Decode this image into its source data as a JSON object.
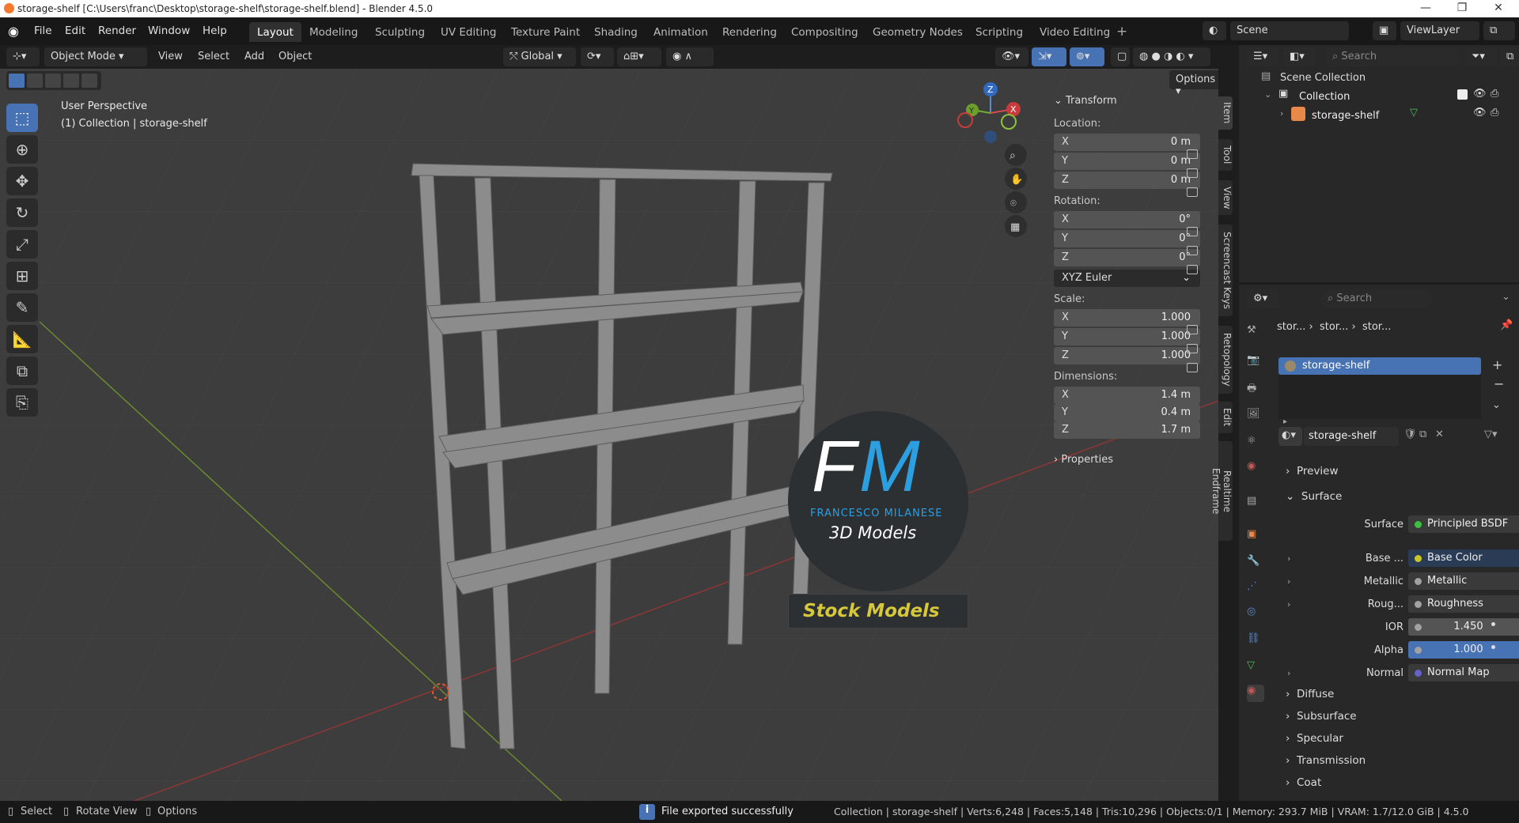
{
  "window": {
    "title": "storage-shelf [C:\\Users\\franc\\Desktop\\storage-shelf\\storage-shelf.blend] - Blender 4.5.0"
  },
  "menu": [
    "File",
    "Edit",
    "Render",
    "Window",
    "Help"
  ],
  "workspaces": [
    "Layout",
    "Modeling",
    "Sculpting",
    "UV Editing",
    "Texture Paint",
    "Shading",
    "Animation",
    "Rendering",
    "Compositing",
    "Geometry Nodes",
    "Scripting",
    "Video Editing"
  ],
  "scene": {
    "label": "Scene",
    "viewlayer": "ViewLayer"
  },
  "viewport_header": {
    "mode": "Object Mode",
    "view": "View",
    "select": "Select",
    "add": "Add",
    "object": "Object",
    "orientation": "Global",
    "options": "Options"
  },
  "viewport": {
    "perspective": "User Perspective",
    "collection_info": "(1) Collection | storage-shelf"
  },
  "watermark": {
    "initials_f": "F",
    "initials_m": "M",
    "name": "FRANCESCO MILANESE",
    "sub": "3D Models",
    "tag": "Stock Models"
  },
  "npanel": {
    "transform": "Transform",
    "location_label": "Location:",
    "location": [
      {
        "k": "X",
        "v": "0 m"
      },
      {
        "k": "Y",
        "v": "0 m"
      },
      {
        "k": "Z",
        "v": "0 m"
      }
    ],
    "rotation_label": "Rotation:",
    "rotation": [
      {
        "k": "X",
        "v": "0°"
      },
      {
        "k": "Y",
        "v": "0°"
      },
      {
        "k": "Z",
        "v": "0°"
      }
    ],
    "rotation_mode": "XYZ Euler",
    "scale_label": "Scale:",
    "scale": [
      {
        "k": "X",
        "v": "1.000"
      },
      {
        "k": "Y",
        "v": "1.000"
      },
      {
        "k": "Z",
        "v": "1.000"
      }
    ],
    "dimensions_label": "Dimensions:",
    "dimensions": [
      {
        "k": "X",
        "v": "1.4 m"
      },
      {
        "k": "Y",
        "v": "0.4 m"
      },
      {
        "k": "Z",
        "v": "1.7 m"
      }
    ],
    "properties": "Properties"
  },
  "side_tabs": [
    "Item",
    "Tool",
    "View",
    "Screencast Keys",
    "Retopology",
    "Edit",
    "Realtime Endframe"
  ],
  "outliner": {
    "search": "Search",
    "scene_collection": "Scene Collection",
    "collection": "Collection",
    "object": "storage-shelf"
  },
  "properties": {
    "search": "Search",
    "breadcrumb": [
      "stor...",
      "stor...",
      "stor..."
    ],
    "material_slot": "storage-shelf",
    "material_name": "storage-shelf",
    "preview": "Preview",
    "surface_section": "Surface",
    "rows": [
      {
        "label": "Surface",
        "value": "Principled BSDF",
        "dot": "#3fbf3f",
        "expand": false
      },
      {
        "label": "Base ...",
        "value": "Base Color",
        "dot": "#c7c729",
        "expand": true
      },
      {
        "label": "Metallic",
        "value": "Metallic",
        "dot": "#a1a1a1",
        "expand": true
      },
      {
        "label": "Roug...",
        "value": "Roughness",
        "dot": "#a1a1a1",
        "expand": true
      },
      {
        "label": "IOR",
        "value": "1.450",
        "dot": "#a1a1a1",
        "expand": false
      },
      {
        "label": "Alpha",
        "value": "1.000",
        "dot": "#a1a1a1",
        "expand": false
      },
      {
        "label": "Normal",
        "value": "Normal Map",
        "dot": "#6363c7",
        "expand": true
      }
    ],
    "subsections": [
      "Diffuse",
      "Subsurface",
      "Specular",
      "Transmission",
      "Coat"
    ]
  },
  "statusbar": {
    "select": "Select",
    "rotate": "Rotate View",
    "options": "Options",
    "message": "File exported successfully",
    "stats": "Collection | storage-shelf | Verts:6,248 | Faces:5,148 | Tris:10,296 | Objects:0/1 | Memory: 293.7 MiB | VRAM: 1.7/12.0 GiB | 4.5.0"
  }
}
